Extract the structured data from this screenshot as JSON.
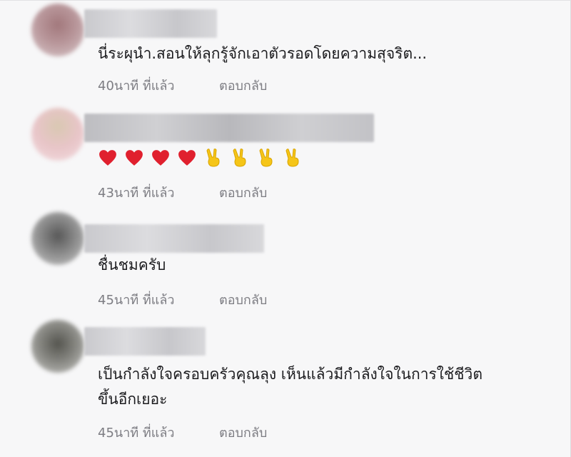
{
  "comments": [
    {
      "text": "นี่ระผุนำ.สอนให้ลุกรู้จักเอาตัวรอดโดยความสุจริต...",
      "time": "40นาที ที่แล้ว",
      "reply": "ตอบกลับ"
    },
    {
      "emojis": [
        "red-heart",
        "red-heart",
        "red-heart",
        "red-heart",
        "victory-hand",
        "victory-hand",
        "victory-hand",
        "victory-hand"
      ],
      "time": "43นาที ที่แล้ว",
      "reply": "ตอบกลับ"
    },
    {
      "text": "ชื่นชมครับ",
      "time": "45นาที ที่แล้ว",
      "reply": "ตอบกลับ"
    },
    {
      "text_lines": [
        "เป็นกำลังใจครอบครัวคุณลุง เห็นแล้วมีกำลังใจในการใช้ชีวิต",
        "ขึ้นอีกเยอะ"
      ],
      "time": "45นาที ที่แล้ว",
      "reply": "ตอบกลับ"
    }
  ],
  "colors": {
    "heart": "#e0202e",
    "victory": "#f5c518",
    "meta_text": "#7d7d83",
    "body_text": "#1b1b1e"
  }
}
